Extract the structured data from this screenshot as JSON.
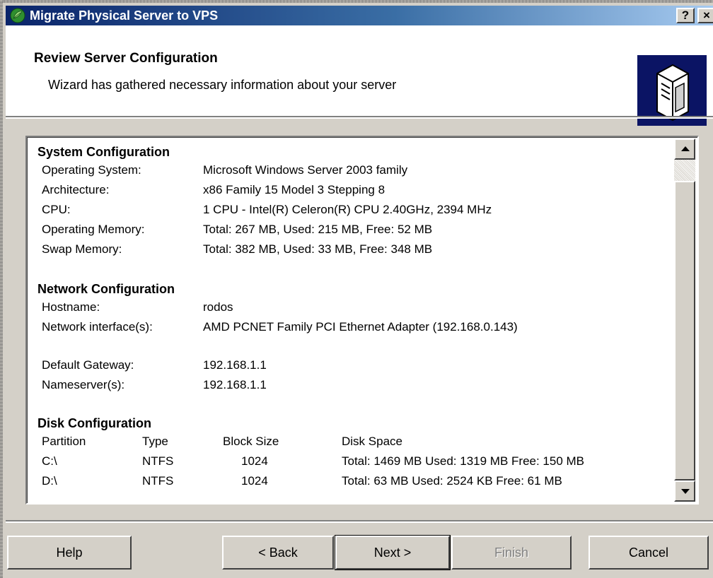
{
  "window": {
    "title": "Migrate Physical Server to VPS",
    "help_button": "?",
    "close_button": "×"
  },
  "header": {
    "title": "Review Server Configuration",
    "subtitle": "Wizard has gathered necessary information about your server",
    "icon": "server-icon"
  },
  "system": {
    "title": "System Configuration",
    "rows": [
      {
        "label": "Operating System:",
        "value": "Microsoft Windows Server 2003 family"
      },
      {
        "label": "Architecture:",
        "value": "x86 Family 15 Model 3 Stepping 8"
      },
      {
        "label": "CPU:",
        "value": "1 CPU - Intel(R) Celeron(R) CPU 2.40GHz, 2394 MHz"
      },
      {
        "label": "Operating Memory:",
        "value": "Total: 267 MB, Used: 215 MB, Free: 52 MB"
      },
      {
        "label": "Swap Memory:",
        "value": "Total: 382 MB, Used: 33 MB, Free: 348 MB"
      }
    ]
  },
  "network": {
    "title": "Network Configuration",
    "rows": [
      {
        "label": "Hostname:",
        "value": "rodos"
      },
      {
        "label": "Network interface(s):",
        "value": "AMD PCNET Family PCI Ethernet Adapter (192.168.0.143)"
      },
      {
        "label": "Default Gateway:",
        "value": "192.168.1.1"
      },
      {
        "label": "Nameserver(s):",
        "value": "192.168.1.1"
      }
    ]
  },
  "disk": {
    "title": "Disk Configuration",
    "headers": [
      "Partition",
      "Type",
      "Block Size",
      "Disk Space"
    ],
    "rows": [
      [
        "C:\\",
        "NTFS",
        "1024",
        "Total: 1469 MB  Used: 1319 MB  Free: 150 MB"
      ],
      [
        "D:\\",
        "NTFS",
        "1024",
        "Total: 63 MB  Used: 2524 KB  Free: 61 MB"
      ]
    ]
  },
  "buttons": {
    "help": "Help",
    "back": "< Back",
    "next": "Next >",
    "finish": "Finish",
    "cancel": "Cancel"
  },
  "colors": {
    "titlebar_start": "#0a246a",
    "titlebar_end": "#a6caf0",
    "dialog_face": "#d4d0c8",
    "header_icon_bg": "#0b1464"
  }
}
